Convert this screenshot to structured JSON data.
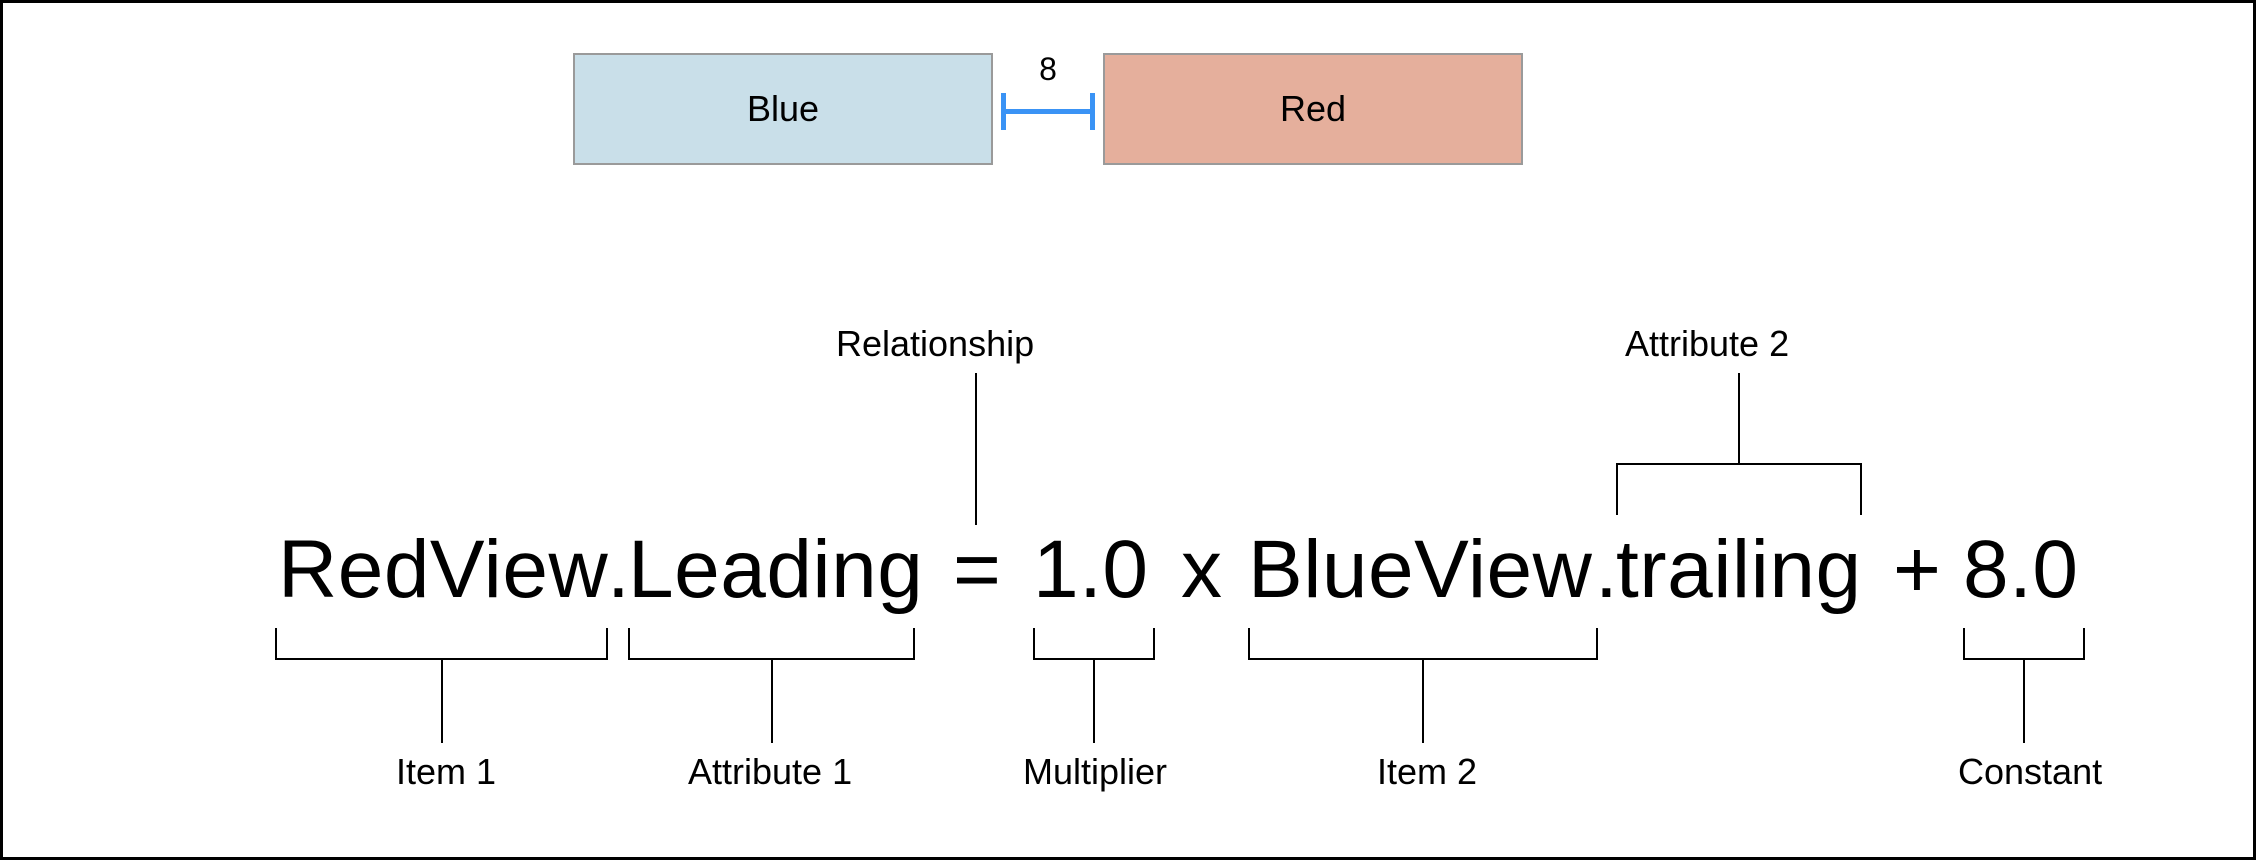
{
  "boxes": {
    "blue_label": "Blue",
    "red_label": "Red",
    "gap_value": "8"
  },
  "equation": {
    "item1": "RedView",
    "dot1": ".",
    "attribute1": "Leading",
    "relationship": "=",
    "multiplier": "1.0",
    "times": "x",
    "item2": "BlueView",
    "dot2": ".",
    "attribute2": "trailing",
    "plus": "+",
    "constant": "8.0"
  },
  "annotations": {
    "relationship": "Relationship",
    "attribute2": "Attribute 2",
    "item1": "Item 1",
    "attribute1": "Attribute 1",
    "multiplier": "Multiplier",
    "item2": "Item 2",
    "constant": "Constant"
  },
  "colors": {
    "blue_box": "#c9dfe9",
    "red_box": "#e5af9c",
    "dimension_line": "#3a93f5"
  }
}
